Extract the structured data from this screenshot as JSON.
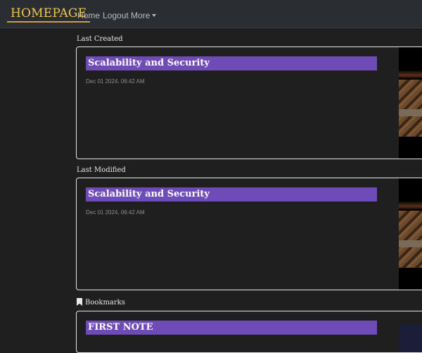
{
  "navbar": {
    "brand": "HOMEPAGE",
    "links": {
      "home": "Home",
      "logout": "Logout",
      "more": "More"
    }
  },
  "sections": {
    "last_created": {
      "label": "Last Created",
      "card": {
        "title": "Scalability and Security",
        "date": "Dec 01 2024, 06:42 AM"
      }
    },
    "last_modified": {
      "label": "Last Modified",
      "card": {
        "title": "Scalability and Security",
        "date": "Dec 01 2024, 06:42 AM"
      }
    },
    "bookmarks": {
      "label": "Bookmarks",
      "icon": "bookmark-icon",
      "card": {
        "title": "FIRST NOTE"
      }
    }
  },
  "colors": {
    "background": "#1f1f20",
    "navbar": "#2b2e31",
    "brand": "#f2c84b",
    "title_bar": "#6f4bb8",
    "card_border": "#e6e6e6"
  }
}
